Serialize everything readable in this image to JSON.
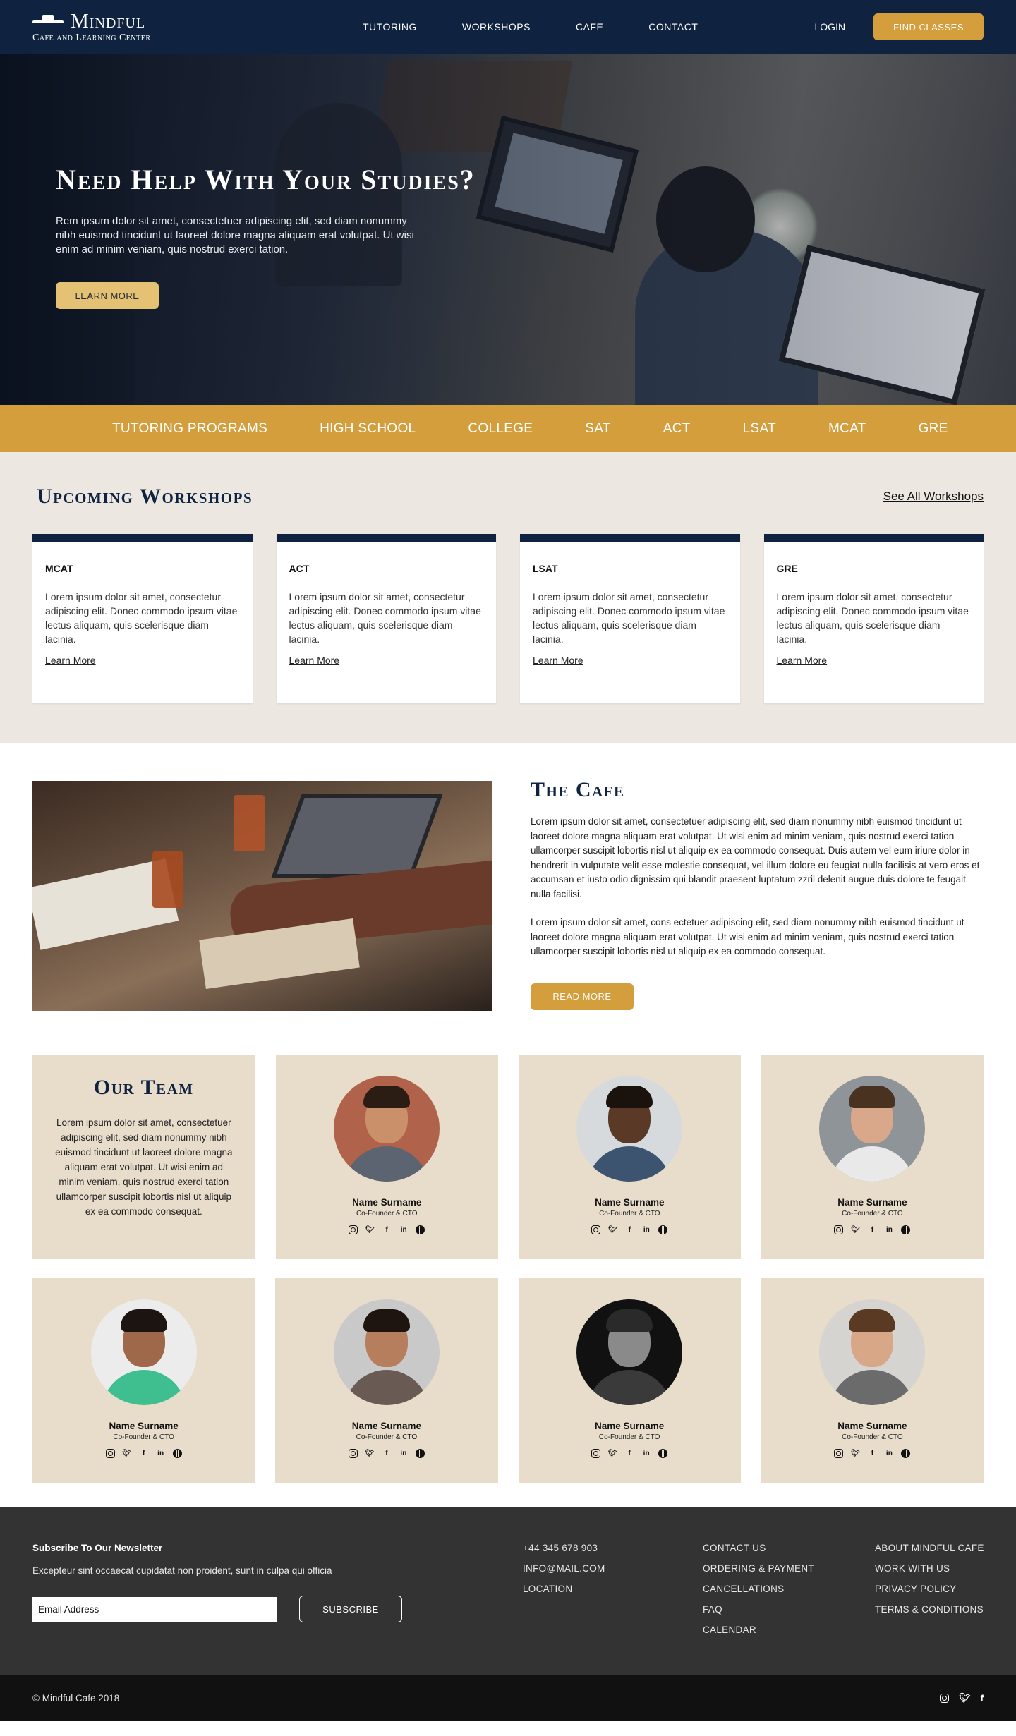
{
  "nav": {
    "logo_name": "Mindful",
    "logo_sub": "Cafe and Learning Center",
    "links": [
      "TUTORING",
      "WORKSHOPS",
      "CAFE",
      "CONTACT"
    ],
    "login": "LOGIN",
    "cta": "FIND CLASSES"
  },
  "hero": {
    "title": "Need Help With Your Studies?",
    "text": "Rem ipsum dolor sit amet, consectetuer adipiscing elit, sed diam nonummy nibh euismod tincidunt ut laoreet dolore magna aliquam erat volutpat. Ut wisi enim ad minim veniam, quis nostrud exerci tation.",
    "button": "LEARN MORE"
  },
  "programs": [
    "TUTORING PROGRAMS",
    "HIGH SCHOOL",
    "COLLEGE",
    "SAT",
    "ACT",
    "LSAT",
    "MCAT",
    "GRE"
  ],
  "workshops": {
    "title": "Upcoming Workshops",
    "see_all": "See All Workshops",
    "cards": [
      {
        "title": "MCAT",
        "text": "Lorem ipsum dolor sit amet, consectetur adipiscing elit. Donec commodo ipsum vitae lectus aliquam, quis scelerisque diam lacinia.",
        "link": "Learn More"
      },
      {
        "title": "ACT",
        "text": "Lorem ipsum dolor sit amet, consectetur adipiscing elit. Donec commodo ipsum vitae lectus aliquam, quis scelerisque diam lacinia.",
        "link": "Learn More"
      },
      {
        "title": "LSAT",
        "text": "Lorem ipsum dolor sit amet, consectetur adipiscing elit. Donec commodo ipsum vitae lectus aliquam, quis scelerisque diam lacinia.",
        "link": "Learn More"
      },
      {
        "title": "GRE",
        "text": "Lorem ipsum dolor sit amet, consectetur adipiscing elit. Donec commodo ipsum vitae lectus aliquam, quis scelerisque diam lacinia.",
        "link": "Learn More"
      }
    ]
  },
  "cafe": {
    "title": "The Cafe",
    "p1": "Lorem ipsum dolor sit amet, consectetuer adipiscing elit, sed diam nonummy nibh euismod tincidunt ut laoreet dolore magna aliquam erat volutpat. Ut wisi enim ad minim veniam, quis nostrud exerci tation ullamcorper suscipit lobortis nisl ut aliquip ex ea commodo consequat. Duis autem vel eum iriure dolor in hendrerit in vulputate velit esse molestie consequat, vel illum dolore eu feugiat nulla facilisis at vero eros et accumsan et iusto odio dignissim qui blandit praesent luptatum zzril delenit augue duis dolore te feugait nulla facilisi.",
    "p2": "Lorem ipsum dolor sit amet, cons ectetuer adipiscing elit, sed diam nonummy nibh euismod tincidunt ut laoreet dolore magna aliquam erat volutpat. Ut wisi enim ad minim veniam, quis nostrud exerci tation ullamcorper suscipit lobortis nisl ut aliquip ex ea commodo consequat.",
    "button": "READ MORE"
  },
  "team": {
    "title": "Our Team",
    "text": "Lorem ipsum dolor sit amet, consectetuer adipiscing elit, sed diam nonummy nibh euismod tincidunt ut laoreet dolore magna aliquam erat volutpat. Ut wisi enim ad minim veniam, quis nostrud exerci tation ullamcorper suscipit lobortis nisl ut aliquip ex ea commodo consequat.",
    "members": [
      {
        "name": "Name Surname",
        "role": "Co-Founder & CTO",
        "skin": "#c9906a",
        "hair": "#2b1d14",
        "shirt": "#5b6470",
        "bg": "#b0634a"
      },
      {
        "name": "Name Surname",
        "role": "Co-Founder & CTO",
        "skin": "#5a3a26",
        "hair": "#1a120c",
        "shirt": "#3c5470",
        "bg": "#d7dadd"
      },
      {
        "name": "Name Surname",
        "role": "Co-Founder & CTO",
        "skin": "#d9a88a",
        "hair": "#4a3220",
        "shirt": "#e9e9e9",
        "bg": "#8f9499"
      },
      {
        "name": "Name Surname",
        "role": "Co-Founder & CTO",
        "skin": "#a0684a",
        "hair": "#1c1410",
        "shirt": "#3fbf8f",
        "bg": "#ececec"
      },
      {
        "name": "Name Surname",
        "role": "Co-Founder & CTO",
        "skin": "#b67e5c",
        "hair": "#1e1510",
        "shirt": "#6a5a54",
        "bg": "#c9c9c9"
      },
      {
        "name": "Name Surname",
        "role": "Co-Founder & CTO",
        "skin": "#8a8a8a",
        "hair": "#2a2a2a",
        "shirt": "#3a3a3a",
        "bg": "#111111"
      },
      {
        "name": "Name Surname",
        "role": "Co-Founder & CTO",
        "skin": "#d8a788",
        "hair": "#5a3a22",
        "shirt": "#6b6b6b",
        "bg": "#d6d4d0"
      }
    ],
    "social_icons": [
      "instagram-icon",
      "twitter-icon",
      "facebook-icon",
      "linkedin-icon",
      "globe-icon"
    ]
  },
  "footer": {
    "newsletter_title": "Subscribe To Our Newsletter",
    "newsletter_text": "Excepteur sint occaecat cupidatat non proident, sunt in culpa qui officia",
    "email_value": "Email Address",
    "subscribe": "SUBSCRIBE",
    "contact": [
      "+44 345 678 903",
      "INFO@MAIL.COM",
      "LOCATION"
    ],
    "help": [
      "CONTACT US",
      "ORDERING & PAYMENT",
      "CANCELLATIONS",
      "FAQ",
      "CALENDAR"
    ],
    "about": [
      "ABOUT MINDFUL CAFE",
      "WORK WITH US",
      "PRIVACY POLICY",
      "TERMS & CONDITIONS"
    ],
    "copyright": "© Mindful Cafe 2018"
  },
  "colors": {
    "navy": "#0f2340",
    "gold": "#d39e3b",
    "beige": "#e8dccb",
    "light": "#ece7e1",
    "dark": "#333333"
  }
}
